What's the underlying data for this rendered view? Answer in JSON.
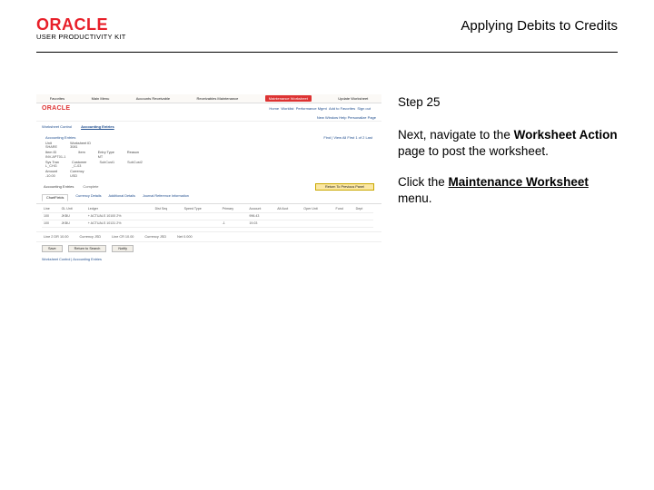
{
  "header": {
    "brand": "ORACLE",
    "product": "USER PRODUCTIVITY KIT",
    "title": "Applying Debits to Credits"
  },
  "step": {
    "label": "Step 25",
    "instruction_prefix": "Next, navigate to the ",
    "instruction_bold": "Worksheet Action",
    "instruction_suffix": " page to post the worksheet.",
    "action_prefix": "Click the ",
    "action_bold_ul": "Maintenance Worksheet",
    "action_suffix": " menu."
  },
  "thumb": {
    "topbar": [
      "Favorites",
      "Main Menu",
      "Accounts Receivable",
      "Receivables Maintenance",
      "Maintenance Worksheet",
      "Update Worksheet"
    ],
    "subbar": [
      "Home",
      "Worklist",
      "Performance Mgmt",
      "Add to Favorites",
      "Sign out"
    ],
    "oracle": "ORACLE",
    "viewline": "New Window  Help  Personalize Page",
    "tabs2": [
      "Worksheet Control",
      "Accounting Entries"
    ],
    "panel": {
      "title": "Accounting Entries",
      "counter": "Find | View All   First  1 of 2  Last",
      "row1": [
        {
          "lbl": "Unit",
          "val": "SHARE"
        },
        {
          "lbl": "Worksheet ID",
          "val": "3081"
        },
        {
          "lbl": "Date",
          "val": ""
        }
      ],
      "row2": [
        {
          "lbl": "Item ID",
          "val": "INV-APT01-1"
        },
        {
          "lbl": "Item",
          "val": ""
        },
        {
          "lbl": "Entry Type",
          "val": "MT"
        },
        {
          "lbl": "Reason",
          "val": ""
        }
      ],
      "row3": [
        {
          "lbl": "Sys Tran",
          "val": "L_CHG"
        },
        {
          "lbl": "Customer",
          "val": "_C-03"
        },
        {
          "lbl": "",
          "val": "SubCust1"
        },
        {
          "lbl": "",
          "val": "SubCust2"
        }
      ],
      "row4": [
        {
          "lbl": "Amount",
          "val": "-10.00"
        },
        {
          "lbl": "Currency",
          "val": "USD"
        }
      ]
    },
    "acctg": {
      "label": "Accounting Entries",
      "status": "Complete",
      "btn": "Return To Previous Panel"
    },
    "innertabs": [
      "ChartFields",
      "Currency Details",
      "Additional Details",
      "Journal Reference Information"
    ],
    "table": {
      "headers": [
        "Line",
        "GL Unit",
        "Ledger",
        "Dist Seq",
        "Speed Type",
        "Primary",
        "Account",
        "Alt Acct",
        "Oper Unit",
        "Fund",
        "Dept"
      ],
      "rows": [
        [
          "100",
          "JKBU",
          "+ ACTUALS 10100 2%",
          "",
          "",
          "",
          "996.43",
          "",
          "",
          "",
          ""
        ],
        [
          "100",
          "JKBU",
          "+ ACTUALS 10131 2%",
          "",
          "",
          "-1",
          "19.03",
          "",
          "",
          "",
          ""
        ]
      ]
    },
    "foot": [
      {
        "l": "Line 2",
        "v": "DR 10.00"
      },
      {
        "l": "Currency",
        "v": "JSD"
      },
      {
        "l": "Line",
        "v": "CR 10.00"
      },
      {
        "l": "Currency",
        "v": "JSD"
      },
      {
        "l": "Net",
        "v": "0.000"
      }
    ],
    "foot2": [
      "Save",
      "Return to Search",
      "Notify"
    ],
    "last": "Worksheet Control | Accounting Entries"
  }
}
